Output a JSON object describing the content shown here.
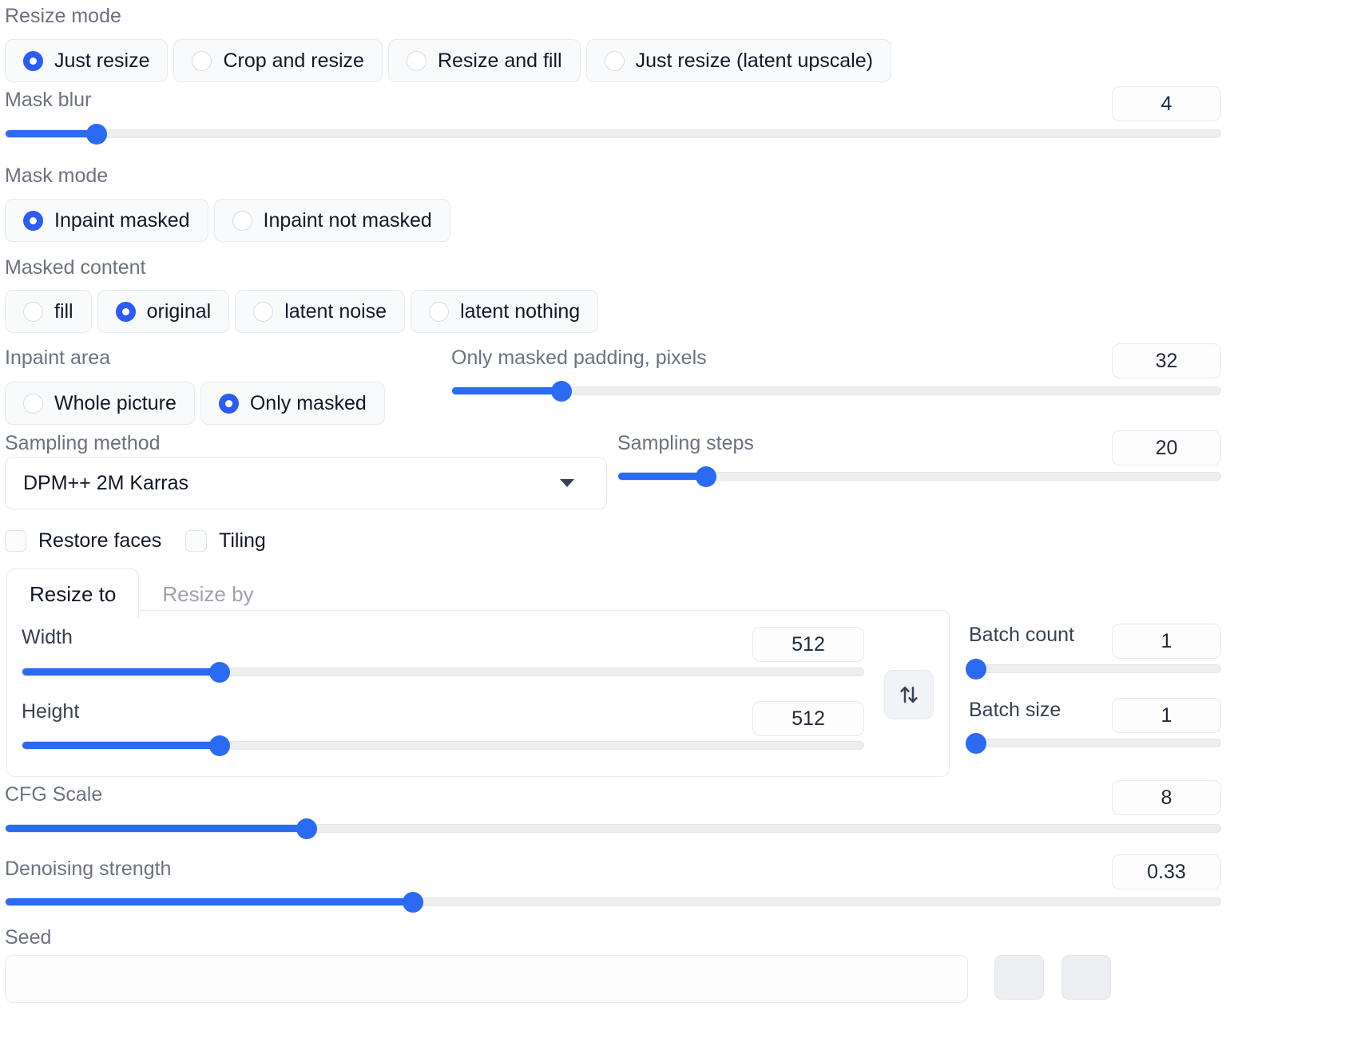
{
  "theme": {
    "accent": "#2b6bf3",
    "radio_accent": "#2b5df5",
    "label_color": "#6b7280",
    "track_color": "#eceef0"
  },
  "resize_mode": {
    "label": "Resize mode",
    "options": [
      {
        "label": "Just resize",
        "selected": true
      },
      {
        "label": "Crop and resize",
        "selected": false
      },
      {
        "label": "Resize and fill",
        "selected": false
      },
      {
        "label": "Just resize (latent upscale)",
        "selected": false
      }
    ]
  },
  "mask_blur": {
    "label": "Mask blur",
    "value": "4",
    "percent": 7.5
  },
  "mask_mode": {
    "label": "Mask mode",
    "options": [
      {
        "label": "Inpaint masked",
        "selected": true
      },
      {
        "label": "Inpaint not masked",
        "selected": false
      }
    ]
  },
  "masked_content": {
    "label": "Masked content",
    "options": [
      {
        "label": "fill",
        "selected": false
      },
      {
        "label": "original",
        "selected": true
      },
      {
        "label": "latent noise",
        "selected": false
      },
      {
        "label": "latent nothing",
        "selected": false
      }
    ]
  },
  "inpaint_area": {
    "label": "Inpaint area",
    "options": [
      {
        "label": "Whole picture",
        "selected": false
      },
      {
        "label": "Only masked",
        "selected": true
      }
    ]
  },
  "only_masked_padding": {
    "label": "Only masked padding, pixels",
    "value": "32",
    "percent": 14.2
  },
  "sampling_method": {
    "label": "Sampling method",
    "value": "DPM++ 2M Karras",
    "caret_icon": "chevron-down-icon"
  },
  "sampling_steps": {
    "label": "Sampling steps",
    "value": "20",
    "percent": 14.6
  },
  "toggles": [
    {
      "label": "Restore faces",
      "checked": false
    },
    {
      "label": "Tiling",
      "checked": false
    }
  ],
  "resize_tabs": [
    {
      "label": "Resize to",
      "active": true
    },
    {
      "label": "Resize by",
      "active": false
    }
  ],
  "width": {
    "label": "Width",
    "value": "512",
    "percent": 23.5
  },
  "height": {
    "label": "Height",
    "value": "512",
    "percent": 23.5
  },
  "swap": {
    "icon": "swap-vertical-icon"
  },
  "batch_count": {
    "label": "Batch count",
    "value": "1",
    "percent": 1.5
  },
  "batch_size": {
    "label": "Batch size",
    "value": "1",
    "percent": 1.5
  },
  "cfg_scale": {
    "label": "CFG Scale",
    "value": "8",
    "percent": 24.8
  },
  "denoising_strength": {
    "label": "Denoising strength",
    "value": "0.33",
    "percent": 33.5
  },
  "seed": {
    "label": "Seed",
    "value": "",
    "placeholder": ""
  },
  "seed_buttons": [
    {
      "name": "recycle-seed-button",
      "label": ""
    },
    {
      "name": "random-seed-button",
      "label": ""
    }
  ]
}
